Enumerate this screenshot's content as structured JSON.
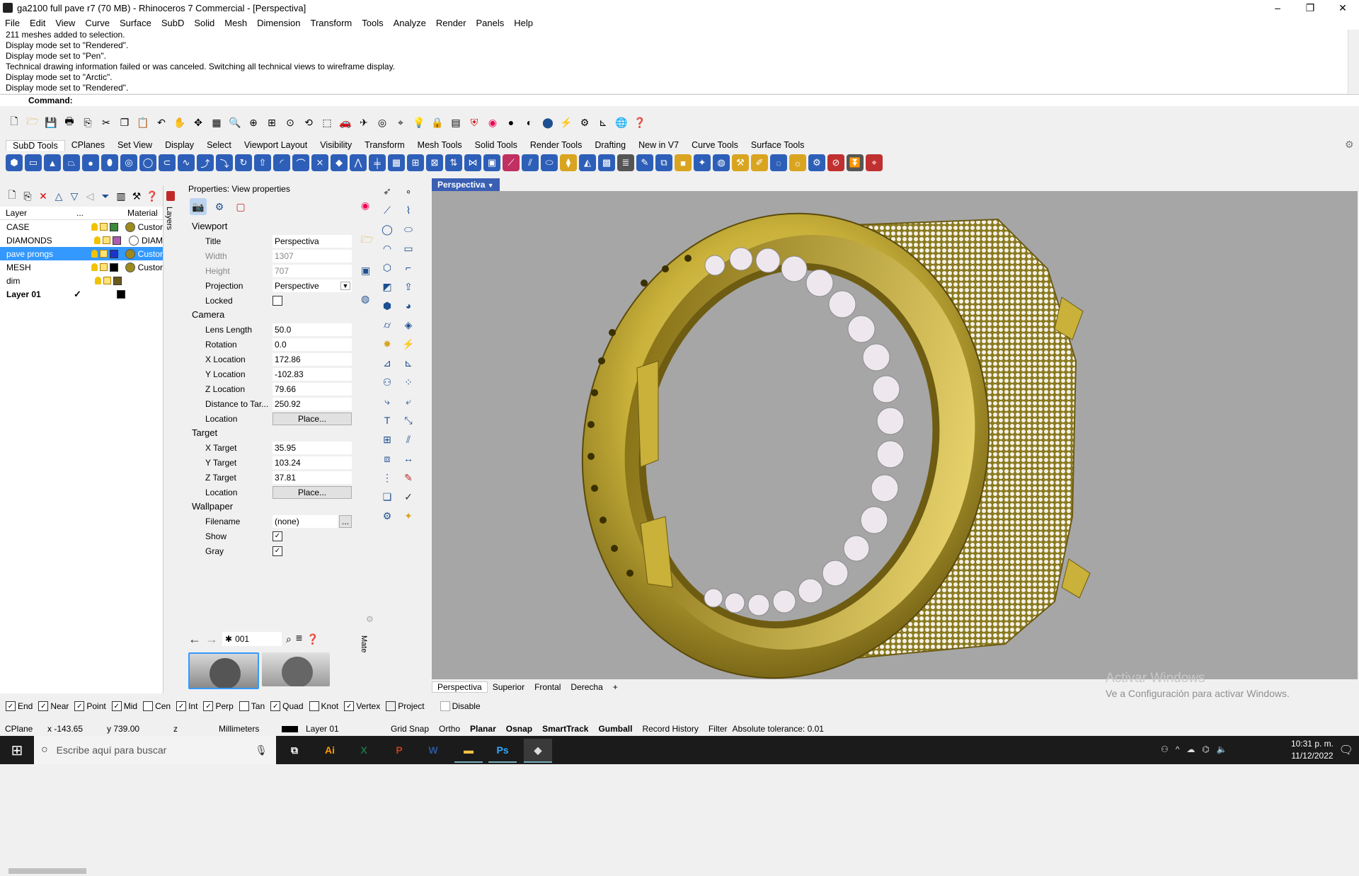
{
  "window": {
    "title": "ga2100 full pave r7 (70 MB) - Rhinoceros 7 Commercial - [Perspectiva]",
    "controls": [
      "–",
      "❐",
      "✕"
    ]
  },
  "menu": [
    "File",
    "Edit",
    "View",
    "Curve",
    "Surface",
    "SubD",
    "Solid",
    "Mesh",
    "Dimension",
    "Transform",
    "Tools",
    "Analyze",
    "Render",
    "Panels",
    "Help"
  ],
  "history": [
    "211 meshes added to selection.",
    "Display mode set to \"Rendered\".",
    "Display mode set to \"Pen\".",
    "Technical drawing information failed or was canceled. Switching all technical views to wireframe display.",
    "Display mode set to \"Arctic\".",
    "Display mode set to \"Rendered\"."
  ],
  "command_label": "Command:",
  "toolbar_tabs": [
    "SubD Tools",
    "CPlanes",
    "Set View",
    "Display",
    "Select",
    "Viewport Layout",
    "Visibility",
    "Transform",
    "Mesh Tools",
    "Solid Tools",
    "Render Tools",
    "Drafting",
    "New in V7",
    "Curve Tools",
    "Surface Tools"
  ],
  "layers": {
    "headers": {
      "layer": "Layer",
      "current": "...",
      "material": "Material"
    },
    "tab_label": "Layers",
    "rows": [
      {
        "name": "CASE",
        "current": "",
        "color": "#3c8a3c",
        "material": "Custor",
        "mat_color": "#9c8a1e",
        "selected": false
      },
      {
        "name": "DIAMONDS",
        "current": "",
        "color": "#b05ab0",
        "material": "DIAM",
        "mat_color": "#ffffff",
        "selected": false
      },
      {
        "name": "pave prongs",
        "current": "",
        "color": "#1b33c8",
        "material": "Custor",
        "mat_color": "#9c8a1e",
        "selected": true
      },
      {
        "name": "MESH",
        "current": "",
        "color": "#000000",
        "material": "Custor",
        "mat_color": "#9c8a1e",
        "selected": false
      },
      {
        "name": "dim",
        "current": "",
        "color": "#6b5a1e",
        "material": "",
        "mat_color": "",
        "selected": false
      },
      {
        "name": "Layer 01",
        "current": "✓",
        "color": "#000000",
        "material": "",
        "mat_color": "",
        "selected": false
      }
    ]
  },
  "properties": {
    "header": "Properties: View properties",
    "sections": {
      "viewport": "Viewport",
      "camera": "Camera",
      "target": "Target",
      "wallpaper": "Wallpaper"
    },
    "viewport": {
      "title_label": "Title",
      "title_value": "Perspectiva",
      "width_label": "Width",
      "width_value": "1307",
      "height_label": "Height",
      "height_value": "707",
      "projection_label": "Projection",
      "projection_value": "Perspective",
      "locked_label": "Locked"
    },
    "camera": {
      "lens_label": "Lens Length",
      "lens_value": "50.0",
      "rotation_label": "Rotation",
      "rotation_value": "0.0",
      "x_label": "X Location",
      "x_value": "172.86",
      "y_label": "Y Location",
      "y_value": "-102.83",
      "z_label": "Z Location",
      "z_value": "79.66",
      "dist_label": "Distance to Tar...",
      "dist_value": "250.92",
      "loc_label": "Location",
      "loc_button": "Place..."
    },
    "target": {
      "x_label": "X Target",
      "x_value": "35.95",
      "y_label": "Y Target",
      "y_value": "103.24",
      "z_label": "Z Target",
      "z_value": "37.81",
      "loc_label": "Location",
      "loc_button": "Place..."
    },
    "wallpaper": {
      "filename_label": "Filename",
      "filename_value": "(none)",
      "browse": "...",
      "show_label": "Show",
      "show_checked": true,
      "gray_label": "Gray",
      "gray_checked": true
    }
  },
  "library": {
    "search_value": "001",
    "tab_label": "Mate"
  },
  "viewport": {
    "active_title": "Perspectiva",
    "tabs": [
      "Perspectiva",
      "Superior",
      "Frontal",
      "Derecha",
      "+"
    ],
    "watermark_line1": "Activar Windows",
    "watermark_line2": "Ve a Configuración para activar Windows."
  },
  "osnaps": [
    {
      "label": "End",
      "checked": true
    },
    {
      "label": "Near",
      "checked": true
    },
    {
      "label": "Point",
      "checked": true
    },
    {
      "label": "Mid",
      "checked": true
    },
    {
      "label": "Cen",
      "checked": false
    },
    {
      "label": "Int",
      "checked": true
    },
    {
      "label": "Perp",
      "checked": true
    },
    {
      "label": "Tan",
      "checked": false
    },
    {
      "label": "Quad",
      "checked": true
    },
    {
      "label": "Knot",
      "checked": false
    },
    {
      "label": "Vertex",
      "checked": true
    },
    {
      "label": "Project",
      "checked": false
    },
    {
      "label": "Disable",
      "checked": false
    }
  ],
  "status": {
    "cplane": "CPlane",
    "x": "x -143.65",
    "y": "y 739.00",
    "z": "z",
    "units": "Millimeters",
    "layer": "Layer 01",
    "items": [
      {
        "label": "Grid Snap",
        "bold": false
      },
      {
        "label": "Ortho",
        "bold": false
      },
      {
        "label": "Planar",
        "bold": true
      },
      {
        "label": "Osnap",
        "bold": true
      },
      {
        "label": "SmartTrack",
        "bold": true
      },
      {
        "label": "Gumball",
        "bold": true
      },
      {
        "label": "Record History",
        "bold": false
      },
      {
        "label": "Filter",
        "bold": false
      }
    ],
    "tolerance": "Absolute tolerance: 0.01"
  },
  "taskbar": {
    "search_placeholder": "Escribe aquí para buscar",
    "apps": [
      {
        "name": "task-view",
        "glyph": "⧉",
        "color": "#ffffff"
      },
      {
        "name": "illustrator",
        "glyph": "Ai",
        "color": "#ff9a00"
      },
      {
        "name": "excel",
        "glyph": "X",
        "color": "#1d7044"
      },
      {
        "name": "powerpoint",
        "glyph": "P",
        "color": "#c43e1c"
      },
      {
        "name": "word",
        "glyph": "W",
        "color": "#2b579a"
      },
      {
        "name": "file-explorer",
        "glyph": "▬",
        "color": "#f3c244"
      },
      {
        "name": "photoshop",
        "glyph": "Ps",
        "color": "#31a8ff"
      },
      {
        "name": "rhino",
        "glyph": "◆",
        "color": "#dcdcdc"
      }
    ],
    "time": "10:31 p. m.",
    "date": "11/12/2022"
  }
}
